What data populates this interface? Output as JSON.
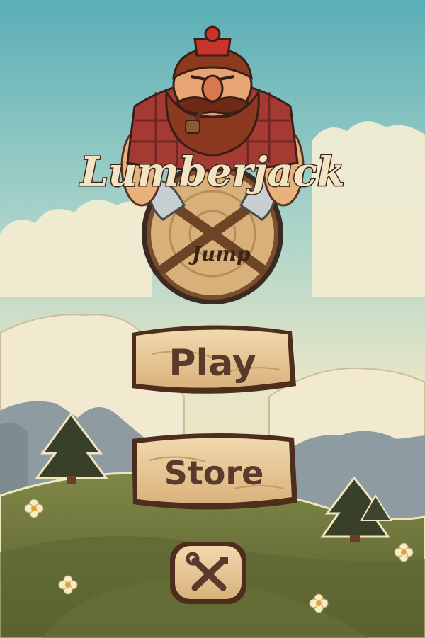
{
  "game": {
    "title_line1": "Lumberjack",
    "title_line2": "Jump"
  },
  "menu": {
    "play_label": "Play",
    "store_label": "Store",
    "settings_icon": "tools-icon"
  },
  "palette": {
    "sky_top": "#5fb3b8",
    "sky_bottom": "#e9e4c2",
    "wood_light": "#e8c99a",
    "wood_dark": "#5a3a22",
    "grass": "#6f7a3f",
    "mountain": "#f3ecd0"
  }
}
